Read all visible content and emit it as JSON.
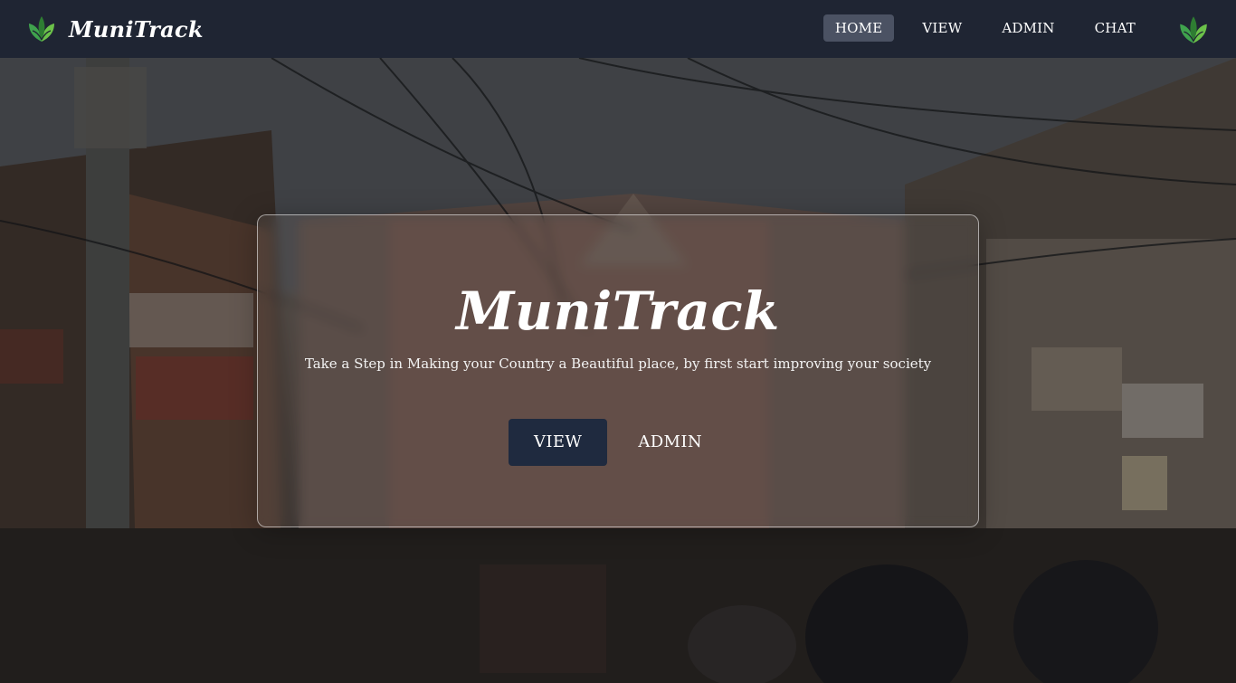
{
  "brand": {
    "name": "MuniTrack",
    "logo_icon": "leaf-logo-icon"
  },
  "nav": {
    "items": [
      {
        "label": "HOME",
        "active": true
      },
      {
        "label": "VIEW",
        "active": false
      },
      {
        "label": "ADMIN",
        "active": false
      },
      {
        "label": "CHAT",
        "active": false
      }
    ],
    "right_icon": "leaf-logo-icon"
  },
  "hero": {
    "title": "MuniTrack",
    "subtitle": "Take a Step in Making your Country a Beautiful place, by first start improving your society",
    "primary_button": "VIEW",
    "secondary_button": "ADMIN"
  },
  "colors": {
    "navbar_bg": "#1f2533",
    "nav_active_bg": "#4b5263",
    "primary_button_bg": "#1f2a3f",
    "logo_green": "#3fa34d"
  }
}
